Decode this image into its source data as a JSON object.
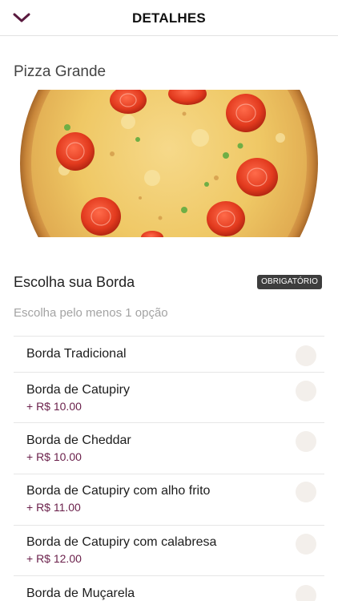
{
  "header": {
    "title": "DETALHES",
    "back_icon": "chevron-down-icon",
    "accent": "#5a1a3f"
  },
  "product": {
    "name": "Pizza Grande"
  },
  "section": {
    "title": "Escolha sua Borda",
    "badge": "OBRIGATÓRIO",
    "subtitle": "Escolha pelo menos 1 opção"
  },
  "options": [
    {
      "label": "Borda Tradicional",
      "price": ""
    },
    {
      "label": "Borda de Catupiry",
      "price": "+ R$ 10.00"
    },
    {
      "label": "Borda de Cheddar",
      "price": "+ R$ 10.00"
    },
    {
      "label": "Borda de Catupiry com alho frito",
      "price": "+ R$ 11.00"
    },
    {
      "label": "Borda de Catupiry com calabresa",
      "price": "+ R$ 12.00"
    },
    {
      "label": "Borda de Muçarela",
      "price": ""
    }
  ]
}
